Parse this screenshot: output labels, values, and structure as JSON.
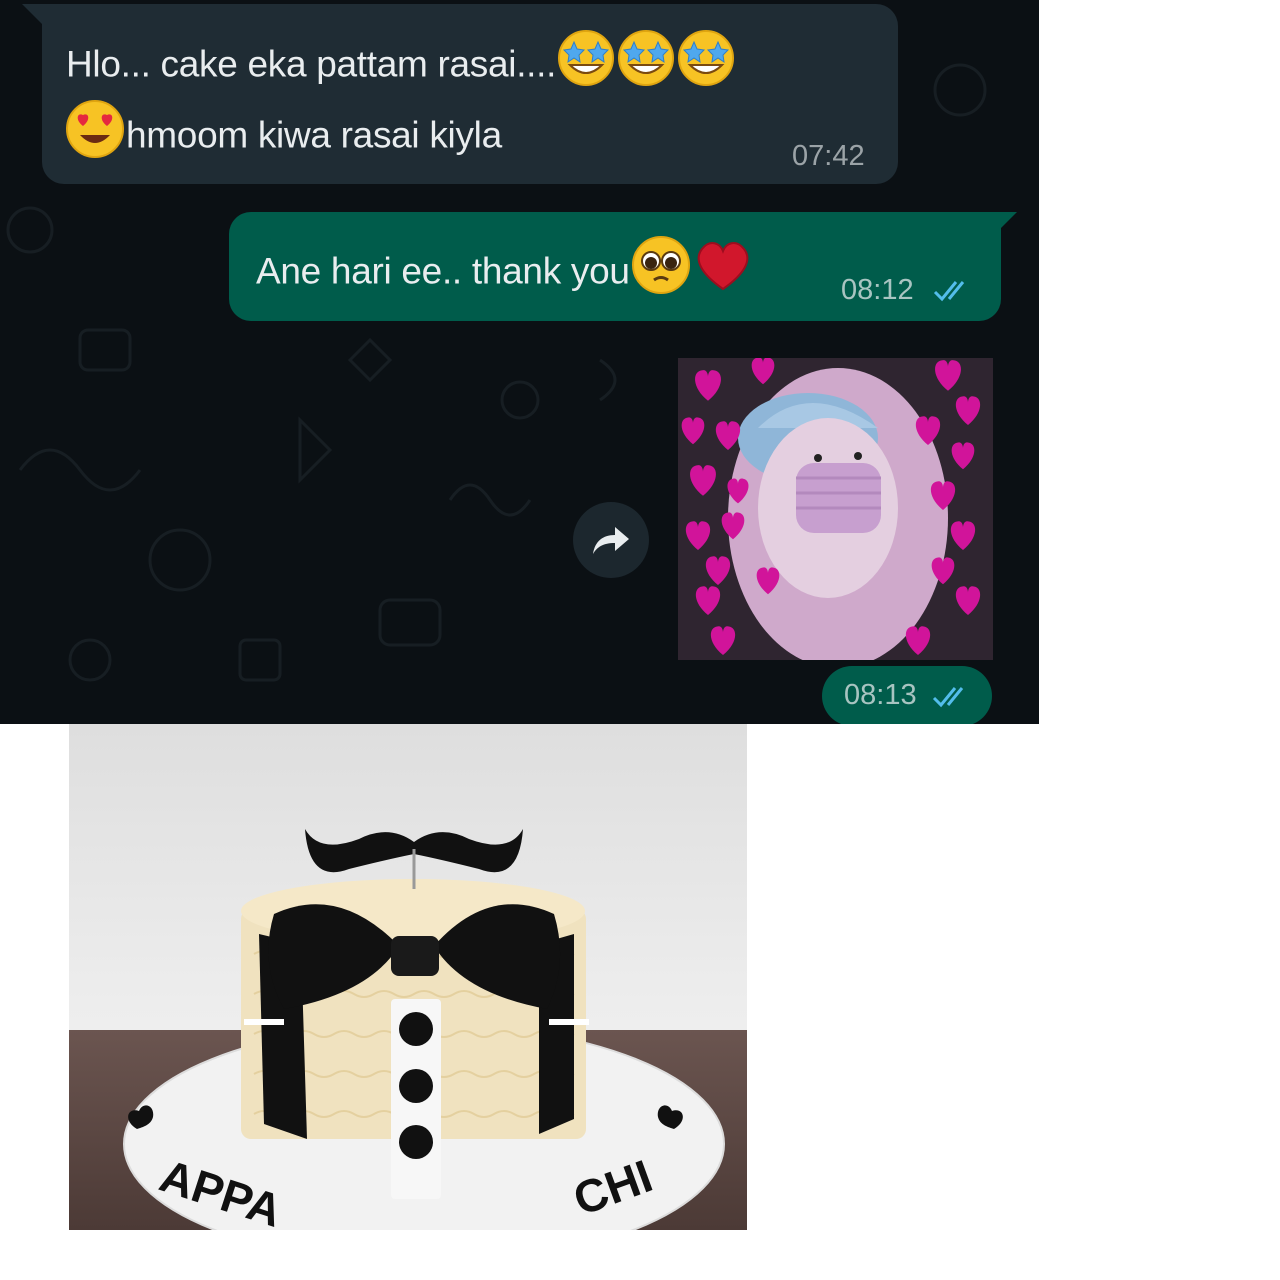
{
  "chat": {
    "background_color": "#0b1014",
    "incoming": {
      "line1_text": "Hlo... cake eka pattam rasai....",
      "line1_emojis": [
        "star-struck-emoji",
        "star-struck-emoji",
        "star-struck-emoji"
      ],
      "line2_emoji": "heart-eyes-emoji",
      "line2_text": "hmoom kiwa rasai kiyla",
      "time": "07:42",
      "color": "#1f2c34"
    },
    "outgoing": {
      "text": "Ane hari ee.. thank you",
      "emojis": [
        "pleading-face-emoji",
        "red-heart-emoji"
      ],
      "time": "08:12",
      "status_icon": "read-double-check-icon",
      "color": "#005c4b"
    },
    "media_message": {
      "content": "cat-with-hearts-sticker",
      "forward_icon": "forward-arrow-icon",
      "time": "08:13",
      "status_icon": "read-double-check-icon"
    },
    "tick_color": "#53bdeb"
  },
  "cake_photo": {
    "plate_text_left": "APPA",
    "plate_text_right": "CHI"
  }
}
